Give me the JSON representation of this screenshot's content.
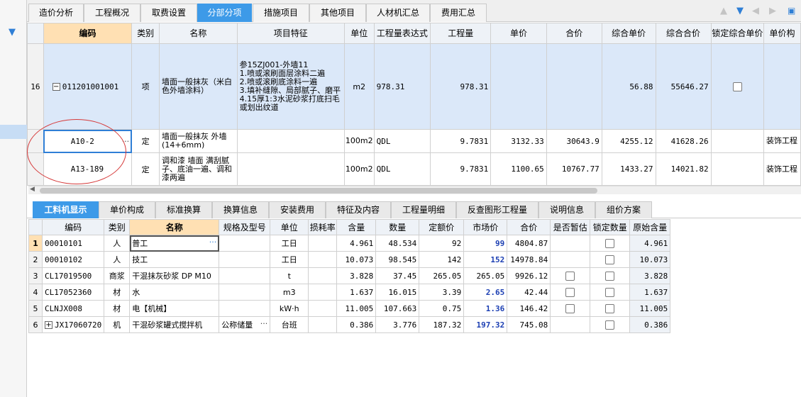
{
  "top_tabs": [
    "造价分析",
    "工程概况",
    "取费设置",
    "分部分项",
    "措施项目",
    "其他项目",
    "人材机汇总",
    "费用汇总"
  ],
  "top_active": 3,
  "grid1": {
    "headers": [
      "编码",
      "类别",
      "名称",
      "项目特征",
      "单位",
      "工程量表达式",
      "工程量",
      "单价",
      "合价",
      "综合单价",
      "综合合价",
      "锁定综合单价",
      "单价构"
    ],
    "rows": [
      {
        "rn": "16",
        "code": "011201001001",
        "type": "项",
        "name": "墙面一般抹灰（米白色外墙涂料）",
        "feature": "参15ZJ001-外墙11\n1.喷或滚刷面层涂料二遍\n2.喷或滚刷底涂料一遍\n3.填补缝隙、局部腻子、磨平\n4.15厚1:3水泥砂浆打底扫毛或划出纹道",
        "unit": "m2",
        "expr": "978.31",
        "qty": "978.31",
        "price": "",
        "total": "",
        "cprice": "56.88",
        "ctotal": "55646.27",
        "lock": true,
        "tpl": ""
      },
      {
        "rn": "",
        "code": "A10-2",
        "type": "定",
        "name": "墙面一般抹灰 外墙(14+6mm)",
        "feature": "",
        "unit": "100m2",
        "expr": "QDL",
        "qty": "9.7831",
        "price": "3132.33",
        "total": "30643.9",
        "cprice": "4255.12",
        "ctotal": "41628.26",
        "lock": false,
        "tpl": "装饰工程"
      },
      {
        "rn": "",
        "code": "A13-189",
        "type": "定",
        "name": "调和漆 墙面 满刮腻子、底油一遍、调和漆两遍",
        "feature": "",
        "unit": "100m2",
        "expr": "QDL",
        "qty": "9.7831",
        "price": "1100.65",
        "total": "10767.77",
        "cprice": "1433.27",
        "ctotal": "14021.82",
        "lock": false,
        "tpl": "装饰工程"
      }
    ]
  },
  "bottom_tabs": [
    "工料机显示",
    "单价构成",
    "标准换算",
    "换算信息",
    "安装费用",
    "特征及内容",
    "工程量明细",
    "反查图形工程量",
    "说明信息",
    "组价方案"
  ],
  "bottom_active": 0,
  "grid2": {
    "headers": [
      "编码",
      "类别",
      "名称",
      "规格及型号",
      "单位",
      "损耗率",
      "含量",
      "数量",
      "定额价",
      "市场价",
      "合价",
      "是否暂估",
      "锁定数量",
      "原始含量"
    ],
    "rows": [
      {
        "rn": "1",
        "code": "00010101",
        "type": "人",
        "name": "普工",
        "spec": "",
        "unit": "工日",
        "loss": "",
        "content": "4.961",
        "amount": "48.534",
        "quota": "92",
        "market": "99",
        "total": "4804.87",
        "est": false,
        "lockq": true,
        "orig": "4.961",
        "expand": false
      },
      {
        "rn": "2",
        "code": "00010102",
        "type": "人",
        "name": "技工",
        "spec": "",
        "unit": "工日",
        "loss": "",
        "content": "10.073",
        "amount": "98.545",
        "quota": "142",
        "market": "152",
        "total": "14978.84",
        "est": false,
        "lockq": true,
        "orig": "10.073",
        "expand": false
      },
      {
        "rn": "3",
        "code": "CL17019500",
        "type": "商浆",
        "name": "干混抹灰砂浆 DP M10",
        "spec": "",
        "unit": "t",
        "loss": "",
        "content": "3.828",
        "amount": "37.45",
        "quota": "265.05",
        "market": "265.05",
        "total": "9926.12",
        "est": true,
        "lockq": true,
        "orig": "3.828",
        "expand": false
      },
      {
        "rn": "4",
        "code": "CL17052360",
        "type": "材",
        "name": "水",
        "spec": "",
        "unit": "m3",
        "loss": "",
        "content": "1.637",
        "amount": "16.015",
        "quota": "3.39",
        "market": "2.65",
        "total": "42.44",
        "est": true,
        "lockq": true,
        "orig": "1.637",
        "expand": false
      },
      {
        "rn": "5",
        "code": "CLNJX008",
        "type": "材",
        "name": "电【机械】",
        "spec": "",
        "unit": "kW·h",
        "loss": "",
        "content": "11.005",
        "amount": "107.663",
        "quota": "0.75",
        "market": "1.36",
        "total": "146.42",
        "est": true,
        "lockq": true,
        "orig": "11.005",
        "expand": false
      },
      {
        "rn": "6",
        "code": "JX17060720",
        "type": "机",
        "name": "干混砂浆罐式搅拌机",
        "spec": "公称储量",
        "unit": "台班",
        "loss": "",
        "content": "0.386",
        "amount": "3.776",
        "quota": "187.32",
        "market": "197.32",
        "total": "745.08",
        "est": false,
        "lockq": true,
        "orig": "0.386",
        "expand": true
      }
    ]
  },
  "icons": {
    "pin": "pin-icon",
    "arrows": [
      "arrow-up-icon",
      "arrow-down-icon",
      "arrow-left-icon",
      "arrow-right-icon"
    ]
  },
  "colors": {
    "accent": "#3d9ae8",
    "header_hl": "#ffe0b3",
    "row_sel": "#dbe8f9",
    "market_blue": "#1c3fb3",
    "annotation": "#d63a3a"
  }
}
